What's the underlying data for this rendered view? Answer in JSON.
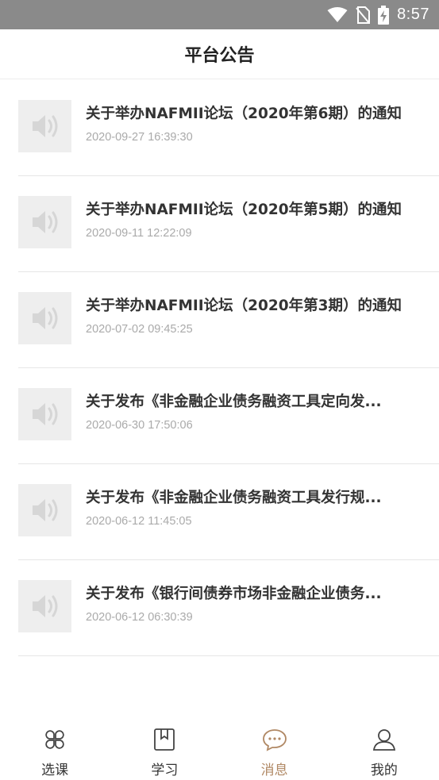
{
  "status_bar": {
    "time": "8:57",
    "icons": [
      "wifi-icon",
      "no-sim-icon",
      "battery-charging-icon"
    ]
  },
  "header": {
    "title": "平台公告"
  },
  "announcements": [
    {
      "title": "关于举办NAFMII论坛（2020年第6期）的通知",
      "date": "2020-09-27 16:39:30",
      "icon": "speaker-icon"
    },
    {
      "title": "关于举办NAFMII论坛（2020年第5期）的通知",
      "date": "2020-09-11 12:22:09",
      "icon": "speaker-icon"
    },
    {
      "title": "关于举办NAFMII论坛（2020年第3期）的通知",
      "date": "2020-07-02 09:45:25",
      "icon": "speaker-icon"
    },
    {
      "title": "关于发布《非金融企业债务融资工具定向发...",
      "date": "2020-06-30 17:50:06",
      "icon": "speaker-icon"
    },
    {
      "title": "关于发布《非金融企业债务融资工具发行规...",
      "date": "2020-06-12 11:45:05",
      "icon": "speaker-icon"
    },
    {
      "title": "关于发布《银行间债券市场非金融企业债务...",
      "date": "2020-06-12 06:30:39",
      "icon": "speaker-icon"
    }
  ],
  "bottom_nav": [
    {
      "label": "选课",
      "icon": "four-petal-icon",
      "active": false
    },
    {
      "label": "学习",
      "icon": "bookmark-book-icon",
      "active": false
    },
    {
      "label": "消息",
      "icon": "chat-bubble-icon",
      "active": true
    },
    {
      "label": "我的",
      "icon": "person-icon",
      "active": false
    }
  ],
  "colors": {
    "accent": "#b08864",
    "status_bar": "#8a8a8a",
    "text": "#333333",
    "muted": "#aaaaaa",
    "thumb_bg": "#eeeeee"
  }
}
